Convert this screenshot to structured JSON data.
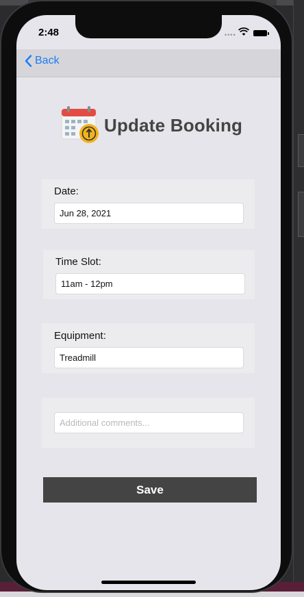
{
  "status_bar": {
    "time": "2:48"
  },
  "nav": {
    "back_label": "Back"
  },
  "header": {
    "title": "Update Booking",
    "icon": "calendar-refresh-icon"
  },
  "form": {
    "date": {
      "label": "Date:",
      "value": "Jun 28, 2021"
    },
    "time_slot": {
      "label": "Time Slot:",
      "value": "11am - 12pm"
    },
    "equipment": {
      "label": "Equipment:",
      "value": "Treadmill"
    },
    "comments": {
      "value": "",
      "placeholder": "Additional comments..."
    }
  },
  "actions": {
    "save_label": "Save"
  },
  "colors": {
    "accent": "#1a7cf5",
    "button": "#444444",
    "background": "#e6e5eb"
  }
}
